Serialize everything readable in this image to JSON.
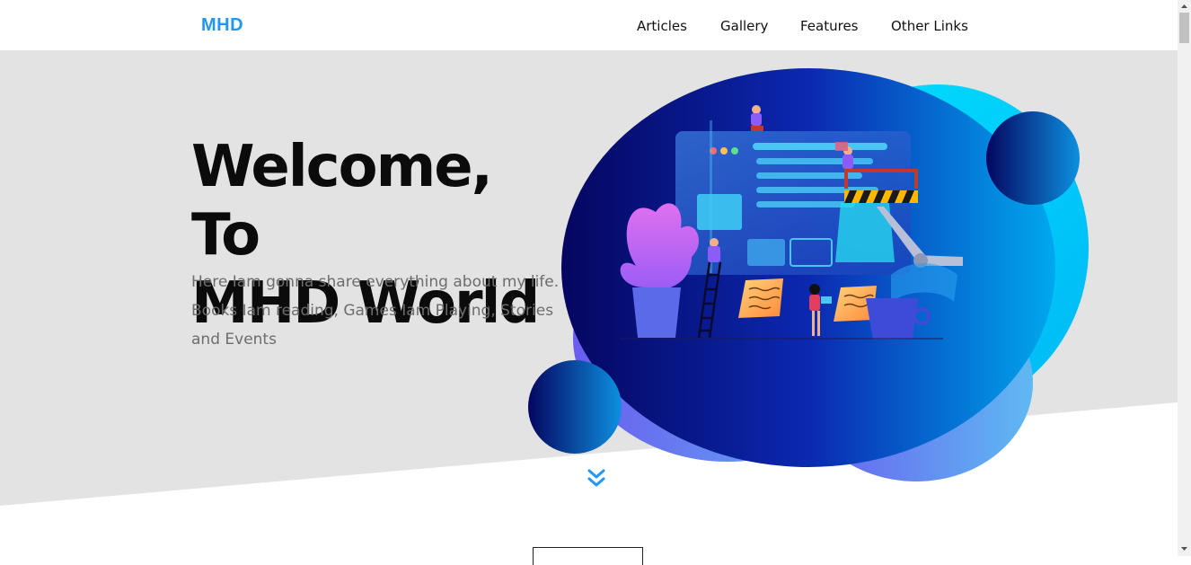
{
  "header": {
    "logo": "MHD",
    "nav": [
      "Articles",
      "Gallery",
      "Features",
      "Other Links"
    ]
  },
  "hero": {
    "title_line1": "Welcome, To",
    "title_line2": "MHD World",
    "subtitle": "Here Iam gonna share everything about my life. Books Iam reading, Games Iam Playing, Stories and Events"
  },
  "icons": {
    "scroll_down": "double-chevron-down-icon"
  },
  "colors": {
    "brand": "#2196f3",
    "hero_bg": "#e3e3e3",
    "blob_dark": "#0a0a6e",
    "blob_cyan": "#00d4ff",
    "blob_purple": "#6b5ff0"
  }
}
